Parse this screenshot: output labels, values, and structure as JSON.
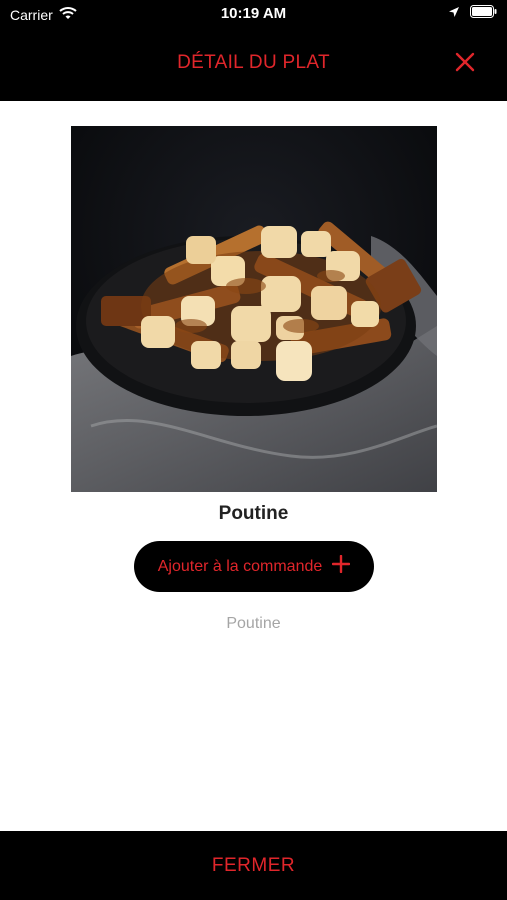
{
  "status_bar": {
    "carrier": "Carrier",
    "time": "10:19 AM",
    "icons": [
      "wifi-icon",
      "location-arrow-icon",
      "battery-icon"
    ]
  },
  "nav": {
    "title": "DÉTAIL DU PLAT",
    "close_icon": "close-icon"
  },
  "dish": {
    "image_alt": "poutine-photo",
    "name": "Poutine",
    "add_button_label": "Ajouter à la commande",
    "add_button_icon": "plus-icon",
    "description": "Poutine"
  },
  "footer": {
    "close_label": "FERMER"
  },
  "colors": {
    "accent": "#e0262b",
    "bar_background": "#000000",
    "description_text": "#a5a5a5"
  }
}
